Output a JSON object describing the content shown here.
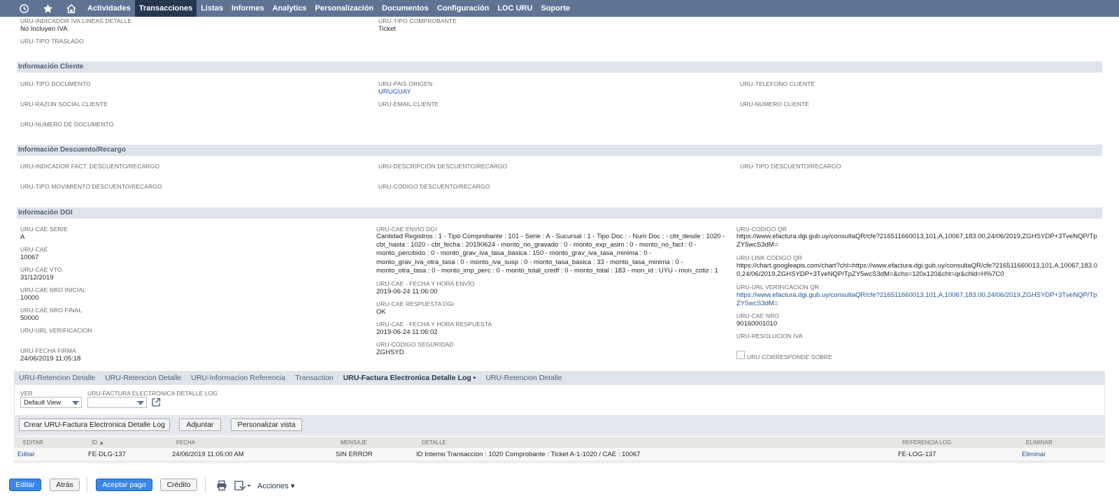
{
  "nav": {
    "items": [
      "Actividades",
      "Transacciones",
      "Listas",
      "Informes",
      "Analytics",
      "Personalización",
      "Documentos",
      "Configuración",
      "LOC URU",
      "Soporte"
    ],
    "active": "Transacciones"
  },
  "top_fields": {
    "iva_label": "URU-INDICADOR IVA LINEAS DETALLE",
    "iva_value": "No Incluyen IVA",
    "tipo_comprobante_label": "URU-TIPO COMPROBANTE",
    "tipo_comprobante_value": "Ticket",
    "tipo_traslado_label": "URU-TIPO TRASLADO"
  },
  "cliente": {
    "title": "Información Cliente",
    "tipo_documento": "URU-TIPO DOCUMENTO",
    "pais_origen": "URU-PAIS ORIGEN",
    "pais_origen_value": "URUGUAY",
    "telefono": "URU-TELEFONO CLIENTE",
    "razon_social": "URU-RAZON SOCIAL CLIENTE",
    "email": "URU-EMAIL CLIENTE",
    "numero_cliente": "URU-NUMERO CLIENTE",
    "numero_documento": "URU-NUMERO DE DOCUMENTO"
  },
  "descuento": {
    "title": "Información Descuento/Recargo",
    "indicador": "URU-INDICADOR FACT. DESCUENTO/RECARGO",
    "descripcion": "URU-DESCRIPCIÓN DESCUENTO/RECARGO",
    "tipo": "URU-TIPO DESCUENTO/RECARGO",
    "tipo_movimiento": "URU-TIPO MOVIMIENTO DESCUENTO/RECARGO",
    "codigo": "URU-CÓDIGO DESCUENTO/RECARGO"
  },
  "dgi": {
    "title": "Información DGI",
    "cae_serie_label": "URU-CAE SERIE",
    "cae_serie": "A",
    "cae_label": "URU-CAE",
    "cae": "10067",
    "cae_vto_label": "URU-CAE VTO.",
    "cae_vto": "31/12/2019",
    "cae_nro_inicial_label": "URU-CAE NRO INICIAL",
    "cae_nro_inicial": "10000",
    "cae_nro_final_label": "URU-CAE NRO FINAL",
    "cae_nro_final": "50000",
    "url_verificacion_label": "URU-URL VERIFICACION",
    "fecha_firma_label": "URU-FECHA FIRMA",
    "fecha_firma": "24/06/2019 11:05:18",
    "envio_label": "URU-CAE ENVIO DGI",
    "envio": "Cantidad Registros : 1 - Tipo Comprobante : 101 - Serie : A - Sucursal : 1 - Tipo Doc : - Num Doc : - cbt_desde : 1020 - cbt_hasta : 1020 - cbt_fecha : 20190624 - monto_no_gravado : 0 - monto_exp_asim : 0 - monto_no_fact : 0 - monto_percibido : 0 - monto_grav_iva_tasa_basica : 150 - monto_grav_iva_tasa_minima : 0 - monto_grav_iva_otra_tasa : 0 - monto_iva_susp : 0 - monto_tasa_basica : 33 - monto_tasa_minima : 0 - monto_otra_tasa : 0 - monto_imp_perc : 0 - monto_total_credf : 0 - monto_total : 183 - mon_id : UYU - mon_cotiz : 1",
    "fecha_envio_label": "URU-CAE - FECHA Y HORA ENVÍO",
    "fecha_envio": "2019-06-24 11:06:00",
    "respuesta_label": "URU-CAE RESPUESTA DGI",
    "respuesta": "OK",
    "fecha_respuesta_label": "URU-CAE - FECHA Y HORA RESPUESTA",
    "fecha_respuesta": "2019-06-24 11:06:02",
    "codigo_seguridad_label": "URU-CODIGO SEGURIDAD",
    "codigo_seguridad": "ZGHSYD",
    "codigo_qr_label": "URU-CODIGO QR",
    "codigo_qr": "https://www.efactura.dgi.gub.uy/consultaQR/cfe?216511660013,101,A,10067,183.00,24/06/2019,ZGHSYDP+3TveNQP/TpZY5wcS3dM=",
    "link_qr_label": "URU-LINK CODIGO QR",
    "link_qr": "https://chart.googleapis.com/chart?chl=https://www.efactura.dgi.gub.uy/consultaQR/cfe?216511660013,101,A,10067,183.00,24/06/2019,ZGHSYDP+3TveNQP/TpZY5wcS3dM=&chs=120x120&cht=qr&chld=H%7C0",
    "url_verif_qr_label": "URU-URL VERIFICACION QR",
    "url_verif_qr": "https://www.efactura.dgi.gub.uy/consultaQR/cfe?216511660013,101,A,10067,183.00,24/06/2019,ZGHSYDP+3TveNQP/TpZY5wcS3dM=",
    "cae_nro_label": "URU-CAE NRO",
    "cae_nro": "90160001010",
    "resolucion_label": "URU-RESOLUCION IVA",
    "corresponde_sobre_label": "URU-CORRESPONDE SOBRE"
  },
  "subtabs": {
    "items": [
      "URU-Retencion Detalle",
      "URU-Retencion Detalle",
      "URU-Informacion Referencia",
      "Transaction",
      "URU-Factura Electronica Detalle Log •",
      "URU-Retencion Detalle"
    ],
    "active_index": 4
  },
  "sublist": {
    "ver_label": "VER",
    "ver_value": "Default View",
    "log_label": "URU-FACTURA ELECTRONICA DETALLE LOG",
    "log_value": "",
    "buttons": {
      "crear": "Crear URU-Factura Electronica Detalle Log",
      "adjuntar": "Adjuntar",
      "personalizar": "Personalizar vista"
    },
    "columns": {
      "editar": "EDITAR",
      "id": "ID ▲",
      "fecha": "FECHA",
      "mensaje": "MENSAJE",
      "detalle": "DETALLE",
      "referencia": "REFERENCIA LOG",
      "eliminar": "ELIMINAR"
    },
    "rows": [
      {
        "editar": "Editar",
        "id": "FE-DLG-137",
        "fecha": "24/06/2019 11:05:00 AM",
        "mensaje": "SIN ERROR",
        "detalle": "ID Interno Transaccion : 1020 Comprobante : Ticket A-1-1020 / CAE : 10067",
        "referencia": "FE-LOG-137",
        "eliminar": "Eliminar"
      }
    ]
  },
  "footer": {
    "editar": "Editar",
    "atras": "Atrás",
    "aceptar_pago": "Aceptar pago",
    "credito": "Crédito",
    "acciones": "Acciones ▾"
  },
  "colors": {
    "nav_bg": "#5f7395",
    "nav_active": "#26364f",
    "section_bg": "#dfe4eb",
    "primary_button": "#3a87e4",
    "link": "#255599"
  }
}
